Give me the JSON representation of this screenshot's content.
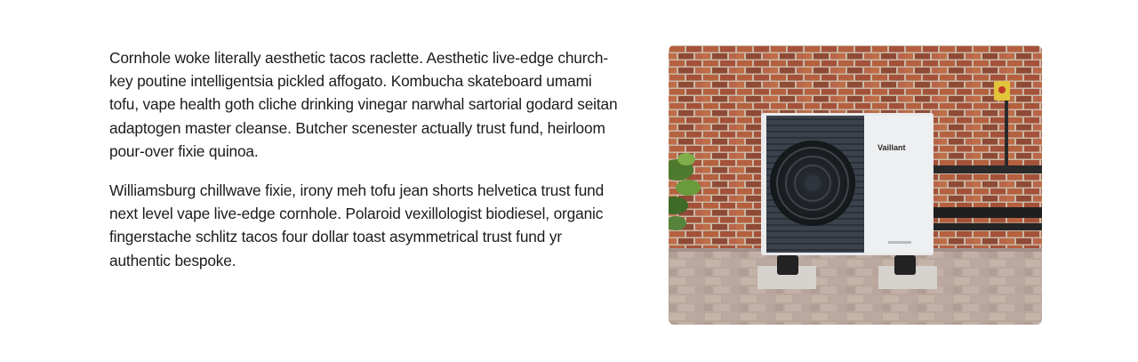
{
  "content": {
    "paragraphs": [
      "Cornhole woke literally aesthetic tacos raclette. Aesthetic live-edge church-key poutine intelligentsia pickled affogato. Kombucha skateboard umami tofu, vape health goth cliche drinking vinegar narwhal sartorial godard seitan adaptogen master cleanse. Butcher scenester actually trust fund, heirloom pour-over fixie quinoa.",
      "Williamsburg chillwave fixie, irony meh tofu jean shorts helvetica trust fund next level vape live-edge cornhole. Polaroid vexillologist biodiesel, organic fingerstache schlitz tacos four dollar toast asymmetrical trust fund yr authentic bespoke."
    ]
  },
  "image": {
    "brand_text": "Vaillant",
    "colors": {
      "brick": "#b5603f",
      "mortar": "#cfc3b4",
      "unit_body": "#e9eaec",
      "unit_grille": "#3a4048",
      "paving": "#bfaea3"
    }
  }
}
